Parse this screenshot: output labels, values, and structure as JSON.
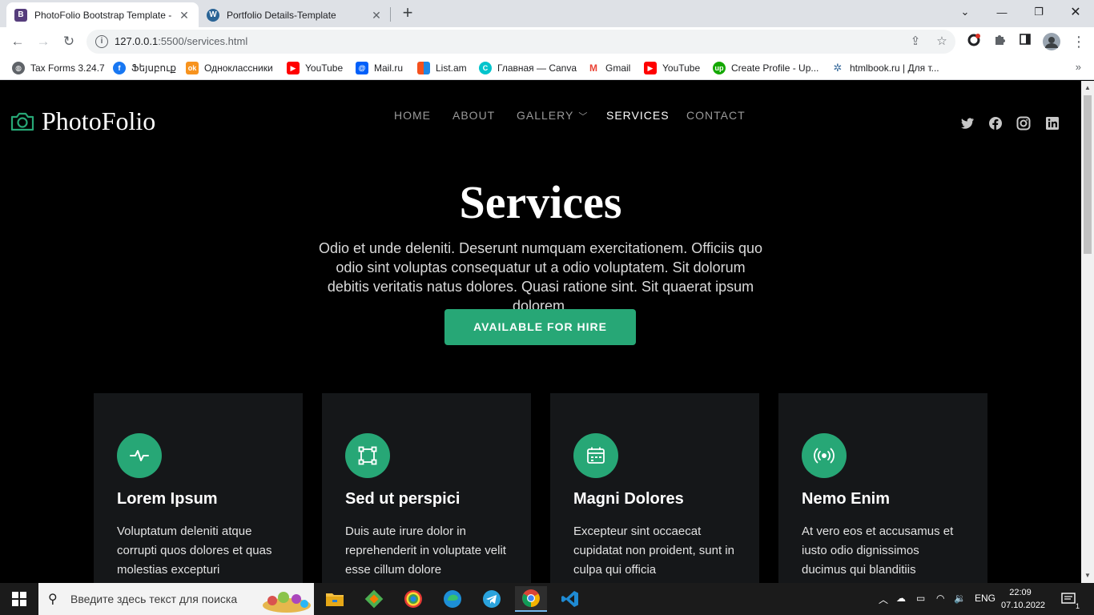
{
  "browser": {
    "tabs": [
      {
        "title": "PhotoFolio Bootstrap Template -",
        "icon": "bootstrap-icon",
        "active": true
      },
      {
        "title": "Portfolio Details-Template",
        "icon": "wordpress-icon",
        "active": false
      }
    ],
    "url_host": "127.0.0.1",
    "url_path": ":5500/services.html",
    "bookmarks": [
      {
        "label": "Tax Forms 3.24.7",
        "icon": "globe-icon"
      },
      {
        "label": "Ֆեյսբուք",
        "icon": "facebook-icon"
      },
      {
        "label": "Одноклассники",
        "icon": "ok-icon"
      },
      {
        "label": "YouTube",
        "icon": "youtube-icon"
      },
      {
        "label": "Mail.ru",
        "icon": "mailru-icon"
      },
      {
        "label": "List.am",
        "icon": "listam-icon"
      },
      {
        "label": "Главная — Canva",
        "icon": "canva-icon"
      },
      {
        "label": "Gmail",
        "icon": "gmail-icon"
      },
      {
        "label": "YouTube",
        "icon": "youtube-icon"
      },
      {
        "label": "Create Profile - Up...",
        "icon": "upwork-icon"
      },
      {
        "label": "htmlbook.ru | Для т...",
        "icon": "htmlbook-icon"
      }
    ]
  },
  "site": {
    "logo": "PhotoFolio",
    "nav": [
      "HOME",
      "ABOUT",
      "GALLERY",
      "SERVICES",
      "CONTACT"
    ],
    "active_nav": "SERVICES",
    "social": [
      "twitter-icon",
      "facebook-icon",
      "instagram-icon",
      "linkedin-icon"
    ],
    "hero": {
      "title": "Services",
      "description": "Odio et unde deleniti. Deserunt numquam exercitationem. Officiis quo odio sint voluptas consequatur ut a odio voluptatem. Sit dolorum debitis veritatis natus dolores. Quasi ratione sint. Sit quaerat ipsum dolorem.",
      "button": "AVAILABLE FOR HIRE"
    },
    "services": [
      {
        "title": "Lorem Ipsum",
        "text": "Voluptatum deleniti atque corrupti quos dolores et quas molestias excepturi",
        "icon": "activity-icon"
      },
      {
        "title": "Sed ut perspici",
        "text": "Duis aute irure dolor in reprehenderit in voluptate velit esse cillum dolore",
        "icon": "bounding-box-icon"
      },
      {
        "title": "Magni Dolores",
        "text": "Excepteur sint occaecat cupidatat non proident, sunt in culpa qui officia",
        "icon": "calendar-icon"
      },
      {
        "title": "Nemo Enim",
        "text": "At vero eos et accusamus et iusto odio dignissimos ducimus qui blanditiis",
        "icon": "broadcast-icon"
      }
    ]
  },
  "taskbar": {
    "search_placeholder": "Введите здесь текст для поиска",
    "language": "ENG",
    "time": "22:09",
    "date": "07.10.2022",
    "notification_count": "1"
  },
  "colors": {
    "accent": "#27a776",
    "page_bg": "#000000",
    "card_bg": "#151719"
  }
}
